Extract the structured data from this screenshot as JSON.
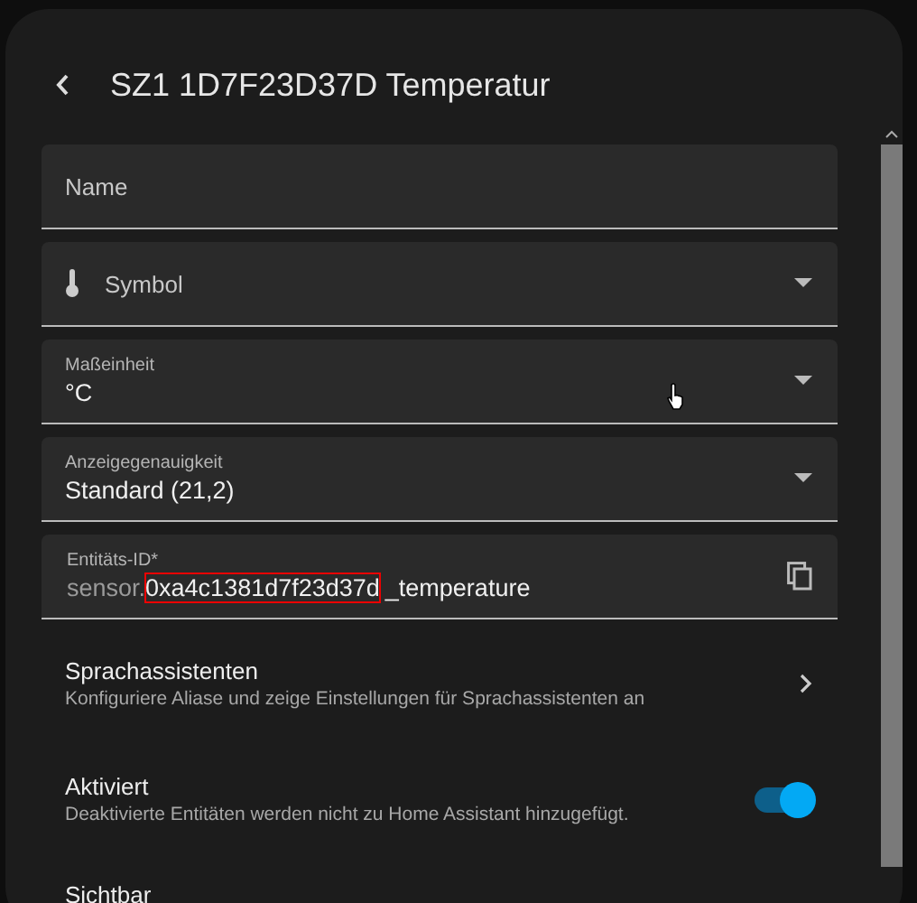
{
  "dialog": {
    "title": "SZ1 1D7F23D37D Temperatur"
  },
  "fields": [
    {
      "kind": "text",
      "label": "Name"
    },
    {
      "kind": "icon-select",
      "label": "Symbol"
    },
    {
      "kind": "select",
      "label": "Maßeinheit",
      "value": "°C"
    },
    {
      "kind": "select",
      "label": "Anzeigegenauigkeit",
      "value": "Standard (21,2)"
    }
  ],
  "entity_id": {
    "label": "Entitäts-ID*",
    "prefix": "sensor.",
    "highlighted": "0xa4c1381d7f23d37d",
    "suffix": "_temperature"
  },
  "rows": [
    {
      "kind": "link",
      "title": "Sprachassistenten",
      "description": "Konfiguriere Aliase und zeige Einstellungen für Sprachassistenten an"
    },
    {
      "kind": "switch",
      "title": "Aktiviert",
      "description": "Deaktivierte Entitäten werden nicht zu Home Assistant hinzugefügt.",
      "on": true
    }
  ],
  "next_section": "Sichtbar"
}
